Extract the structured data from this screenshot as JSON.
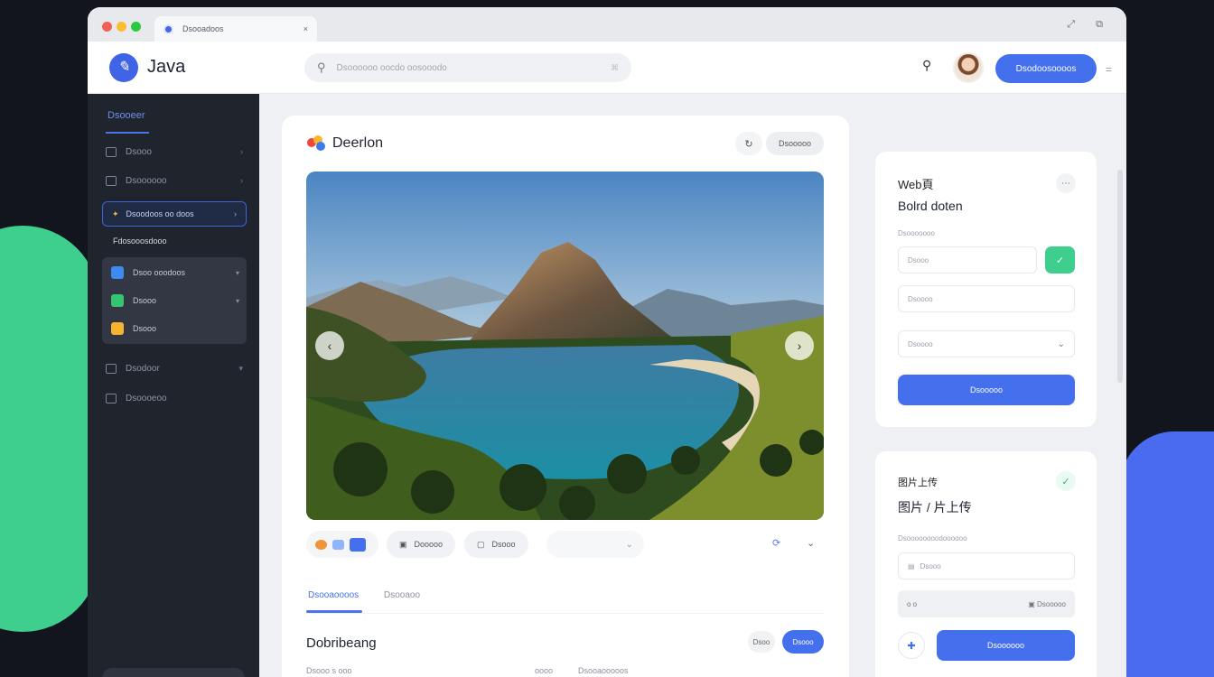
{
  "window": {
    "tab_title": "Dsooadoos",
    "tab_close": "×",
    "controls": "⤢ ⧉"
  },
  "appbar": {
    "brand": "Java",
    "search_placeholder": "Dsoooooo oocdo oosooodo",
    "search_shortcut": "⌘",
    "primary_button": "Dsodoosoooos",
    "kebab": "="
  },
  "sidebar": {
    "heading": "Dsooeer",
    "items": [
      {
        "label": "Dsooo"
      },
      {
        "label": "Dsoooooo"
      },
      {
        "label": "Dsodoor"
      },
      {
        "label": "Dsoooeoo"
      }
    ],
    "active_item": "Dsoodoos oo doos",
    "subheading": "Fdosooosdooo",
    "group": [
      {
        "label": "Dsoo ooodoos",
        "color": "#3d8af0"
      },
      {
        "label": "Dsooo",
        "color": "#35c46f"
      },
      {
        "label": "Dsooo",
        "color": "#f5b52e"
      }
    ]
  },
  "main": {
    "title": "Deerlon",
    "pill": "Dsooooo",
    "toolbar": {
      "chip1": "Dooooo",
      "chip2": "Dsooo"
    },
    "tabs": [
      "Dsooaoooos",
      "Dsooaoo"
    ],
    "section_title": "Dobribeang",
    "ghost_btn": "Dsoo",
    "section_btn": "Dsooo",
    "row": [
      "Dsooo s ooo",
      "oooo",
      "Dsooaooooos"
    ]
  },
  "card1": {
    "title": "Web頁",
    "subtitle": "Bolrd doten",
    "label": "Dsooooooo",
    "field1": "Dsooo",
    "field2": "Dsoooo",
    "select": "Dsoooo",
    "button": "Dsooooo"
  },
  "card2": {
    "title": "图片上传",
    "subtitle": "图片 / 片上传",
    "label": "Dsoooooooodoooooo",
    "field1": "Dsooo",
    "gray_left": "o o",
    "gray_right": "Dsooooo",
    "button": "Dsoooooo"
  },
  "colors": {
    "accent": "#4470ee",
    "success": "#3ecf8e",
    "sidebar": "#20242d"
  }
}
